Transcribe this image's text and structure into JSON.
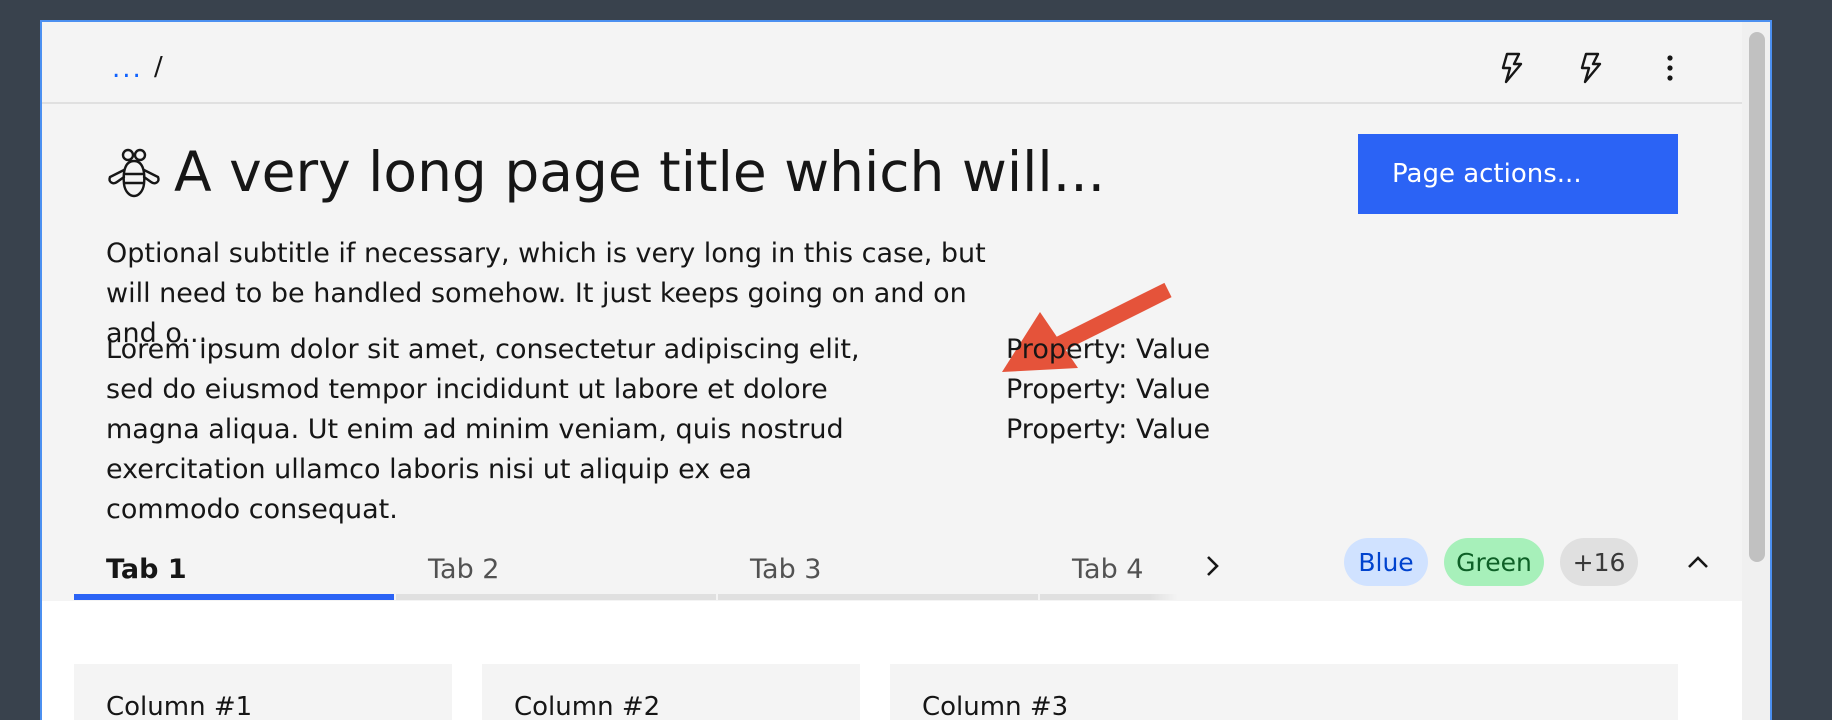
{
  "breadcrumb": {
    "ellipsis": "...",
    "separator": "/"
  },
  "header": {
    "title": "A very long page title which will...",
    "subtitle": "Optional subtitle if necessary, which is very long in this case, but will need to be handled somehow. It just keeps going on and on and o...",
    "description": "Lorem ipsum dolor sit amet, consectetur adipiscing elit, sed do eiusmod tempor incididunt ut labore et dolore magna aliqua. Ut enim ad minim veniam, quis nostrud exercitation ullamco laboris nisi ut aliquip ex ea commodo consequat.",
    "properties": [
      "Property: Value",
      "Property: Value",
      "Property: Value"
    ],
    "action_label": "Page actions..."
  },
  "tabs": [
    {
      "label": "Tab 1",
      "active": true
    },
    {
      "label": "Tab 2",
      "active": false
    },
    {
      "label": "Tab 3",
      "active": false
    },
    {
      "label": "Tab 4",
      "active": false
    }
  ],
  "tags": [
    {
      "label": "Blue",
      "bg": "#d0e2ff",
      "fg": "#0043ce"
    },
    {
      "label": "Green",
      "bg": "#a7f0ba",
      "fg": "#0e6027"
    },
    {
      "label": "+16",
      "bg": "#e0e0e0",
      "fg": "#393939"
    }
  ],
  "cards": [
    "Column #1",
    "Column #2",
    "Column #3"
  ],
  "colors": {
    "accent": "#2b63f5",
    "annotation_arrow": "#e5533a",
    "page_bg": "#f4f4f4"
  },
  "icons": {
    "top_actions": [
      "lightning-icon",
      "lightning-icon",
      "overflow-menu-icon"
    ],
    "title": "bee-icon",
    "tab_scroll": "chevron-right-icon",
    "collapse": "chevron-up-icon"
  }
}
